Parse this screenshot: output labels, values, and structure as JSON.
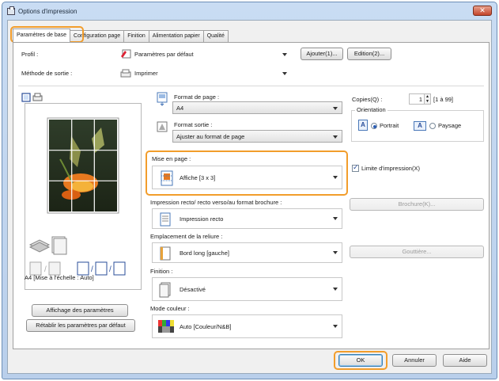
{
  "window": {
    "title": "Options d'impression"
  },
  "tabs": [
    "Paramètres de base",
    "Configuration page",
    "Finition",
    "Alimentation papier",
    "Qualité"
  ],
  "profile": {
    "label": "Profil :",
    "value": "Paramètres par défaut",
    "add_label": "Ajouter(1)...",
    "edit_label": "Edition(2)..."
  },
  "output": {
    "label": "Méthode de sortie :",
    "value": "Imprimer"
  },
  "preview": {
    "caption": "A4 [Mise à l'échelle : Auto]"
  },
  "left_buttons": {
    "show_settings": "Affichage des paramètres",
    "restore_defaults": "Rétablir les paramètres par défaut"
  },
  "page_size": {
    "label": "Format de page :",
    "value": "A4"
  },
  "output_size": {
    "label": "Format sortie :",
    "value": "Ajuster au format de page"
  },
  "layout": {
    "label": "Mise en page :",
    "value": "Affiche [3 x 3]"
  },
  "print_limit": {
    "label": "Limite d'impression(X)",
    "checked": true
  },
  "duplex": {
    "label": "Impression recto/ recto verso/au format brochure :",
    "value": "Impression recto",
    "booklet_label": "Brochure(K)..."
  },
  "binding": {
    "label": "Emplacement de la reliure :",
    "value": "Bord long [gauche]",
    "gutter_label": "Gouttière..."
  },
  "finishing": {
    "label": "Finition :",
    "value": "Désactivé"
  },
  "color_mode": {
    "label": "Mode couleur :",
    "value": "Auto [Couleur/N&B]"
  },
  "copies": {
    "label": "Copies(Q) :",
    "value": "1",
    "range": "[1 à 99]"
  },
  "orientation": {
    "label": "Orientation",
    "portrait": "Portrait",
    "landscape": "Paysage",
    "selected": "Portrait"
  },
  "footer": {
    "ok": "OK",
    "cancel": "Annuler",
    "help": "Aide"
  },
  "colors": {
    "highlight": "#f29d2b",
    "ok_border": "#3c7fb1"
  }
}
